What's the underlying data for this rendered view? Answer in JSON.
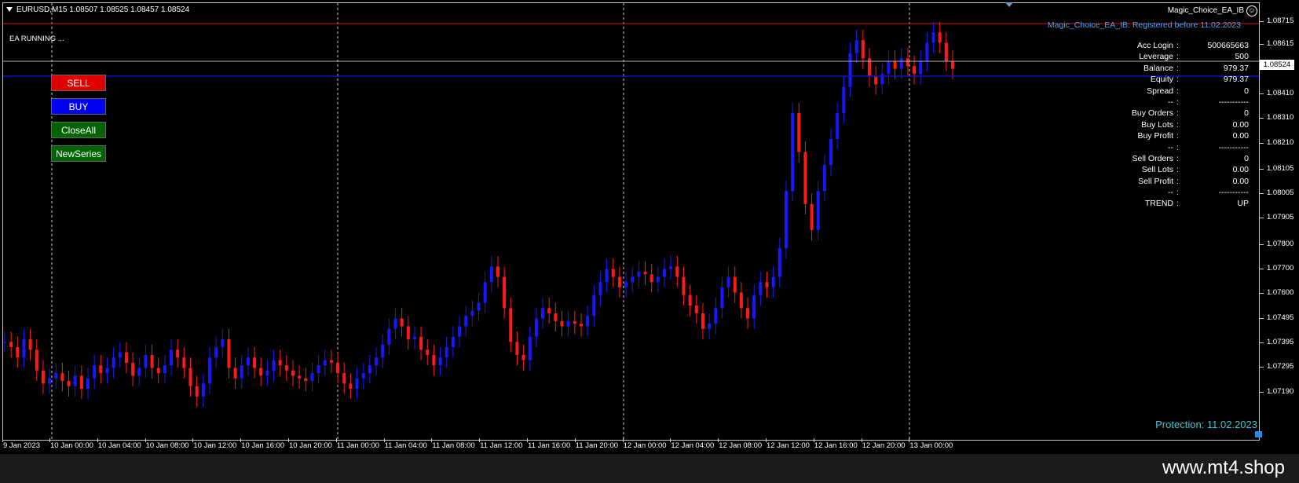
{
  "header": {
    "symbol_line": "EURUSD,M15  1.08507 1.08525 1.08457 1.08524",
    "ea_name": "Magic_Choice_EA_IB",
    "registration": "Magic_Choice_EA_IB: Registered before 11.02.2023",
    "status": "EA RUNNING ..."
  },
  "buttons": {
    "sell": "SELL",
    "buy": "BUY",
    "close_all": "CloseAll",
    "new_series": "NewSeries"
  },
  "info_panel": [
    {
      "label": "Acc Login",
      "value": "500665663"
    },
    {
      "label": "Leverage",
      "value": "500"
    },
    {
      "label": "Balance",
      "value": "979.37"
    },
    {
      "label": "Equity",
      "value": "979.37"
    },
    {
      "label": "Spread",
      "value": "0"
    },
    {
      "label": "--",
      "value": "-----------"
    },
    {
      "label": "Buy Orders",
      "value": "0"
    },
    {
      "label": "Buy Lots",
      "value": "0.00"
    },
    {
      "label": "Buy Profit",
      "value": "0.00"
    },
    {
      "label": "--",
      "value": "-----------"
    },
    {
      "label": "Sell Orders",
      "value": "0"
    },
    {
      "label": "Sell Lots",
      "value": "0.00"
    },
    {
      "label": "Sell Profit",
      "value": "0.00"
    },
    {
      "label": "--",
      "value": "-----------"
    },
    {
      "label": "TREND",
      "value": "UP"
    }
  ],
  "info_separator": ":",
  "protection": "Protection: 11.02.2023",
  "footer": "www.mt4.shop",
  "current_price": "1.08524",
  "price_axis": [
    "1.08715",
    "1.08615",
    "1.08410",
    "1.08310",
    "1.08210",
    "1.08105",
    "1.08005",
    "1.07905",
    "1.07800",
    "1.07700",
    "1.07600",
    "1.07495",
    "1.07395",
    "1.07295",
    "1.07190"
  ],
  "time_axis": [
    "9 Jan 2023",
    "10 Jan 00:00",
    "10 Jan 04:00",
    "10 Jan 08:00",
    "10 Jan 12:00",
    "10 Jan 16:00",
    "10 Jan 20:00",
    "11 Jan 00:00",
    "11 Jan 04:00",
    "11 Jan 08:00",
    "11 Jan 12:00",
    "11 Jan 16:00",
    "11 Jan 20:00",
    "12 Jan 00:00",
    "12 Jan 04:00",
    "12 Jan 08:00",
    "12 Jan 12:00",
    "12 Jan 16:00",
    "12 Jan 20:00",
    "13 Jan 00:00"
  ],
  "chart_data": {
    "type": "line",
    "title": "EURUSD,M15",
    "ylim": [
      1.0713,
      1.0876
    ],
    "candles_close": [
      1.0747,
      1.0745,
      1.0741,
      1.0748,
      1.0744,
      1.0736,
      1.0731,
      1.0733,
      1.0735,
      1.0732,
      1.073,
      1.0734,
      1.0729,
      1.0733,
      1.0738,
      1.0735,
      1.0737,
      1.0741,
      1.0743,
      1.0739,
      1.0734,
      1.0737,
      1.0742,
      1.0737,
      1.0735,
      1.0738,
      1.0744,
      1.0741,
      1.0737,
      1.073,
      1.0726,
      1.0731,
      1.0741,
      1.0745,
      1.0748,
      1.0737,
      1.0733,
      1.0738,
      1.0741,
      1.0737,
      1.0734,
      1.0736,
      1.074,
      1.0738,
      1.0736,
      1.0734,
      1.0733,
      1.0732,
      1.0735,
      1.0738,
      1.074,
      1.0739,
      1.0735,
      1.0731,
      1.0729,
      1.0733,
      1.0735,
      1.0738,
      1.0741,
      1.0746,
      1.0752,
      1.0756,
      1.0753,
      1.0748,
      1.0749,
      1.0744,
      1.0742,
      1.0738,
      1.0741,
      1.0745,
      1.0749,
      1.0753,
      1.0757,
      1.0759,
      1.0762,
      1.077,
      1.0776,
      1.0772,
      1.076,
      1.0747,
      1.0742,
      1.074,
      1.0749,
      1.0756,
      1.076,
      1.0758,
      1.0755,
      1.0753,
      1.0755,
      1.0754,
      1.0753,
      1.0757,
      1.0765,
      1.077,
      1.0775,
      1.0772,
      1.0768,
      1.077,
      1.0772,
      1.0774,
      1.0773,
      1.077,
      1.0772,
      1.0775,
      1.0776,
      1.0772,
      1.0765,
      1.0761,
      1.0758,
      1.0752,
      1.0754,
      1.076,
      1.0768,
      1.0772,
      1.0766,
      1.076,
      1.0756,
      1.0765,
      1.077,
      1.0768,
      1.0772,
      1.0783,
      1.0805,
      1.0835,
      1.082,
      1.08,
      1.079,
      1.0805,
      1.0815,
      1.0825,
      1.0835,
      1.0845,
      1.0858,
      1.0863,
      1.0856,
      1.0849,
      1.0846,
      1.085,
      1.0855,
      1.0852,
      1.0856,
      1.0853,
      1.085,
      1.0855,
      1.0862,
      1.0866,
      1.0862,
      1.0855,
      1.0852
    ]
  }
}
